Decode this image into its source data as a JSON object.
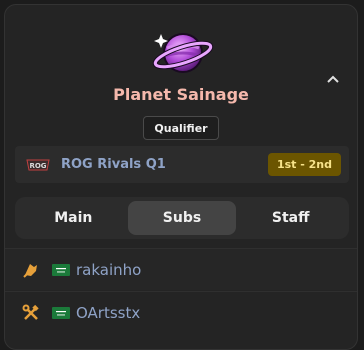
{
  "team": {
    "name": "Planet Sainage",
    "badge": "Qualifier",
    "logo_icon": "planet-icon"
  },
  "event": {
    "name": "ROG Rivals Q1",
    "placement": "1st - 2nd",
    "logo_icon": "rog-logo-icon",
    "logo_text": "ROG"
  },
  "tabs": [
    {
      "label": "Main",
      "active": false
    },
    {
      "label": "Subs",
      "active": true
    },
    {
      "label": "Staff",
      "active": false
    }
  ],
  "players": [
    {
      "name": "rakainho",
      "role_icon": "coach-icon",
      "flag": "saudi-arabia-flag-icon"
    },
    {
      "name": "OArtsstx",
      "role_icon": "tools-icon",
      "flag": "saudi-arabia-flag-icon"
    }
  ],
  "colors": {
    "team_name": "#f5b8ac",
    "player_name": "#8fa3c7",
    "placement_bg": "#6b5500",
    "placement_text": "#f7e38a",
    "active_tab": "#444444"
  }
}
